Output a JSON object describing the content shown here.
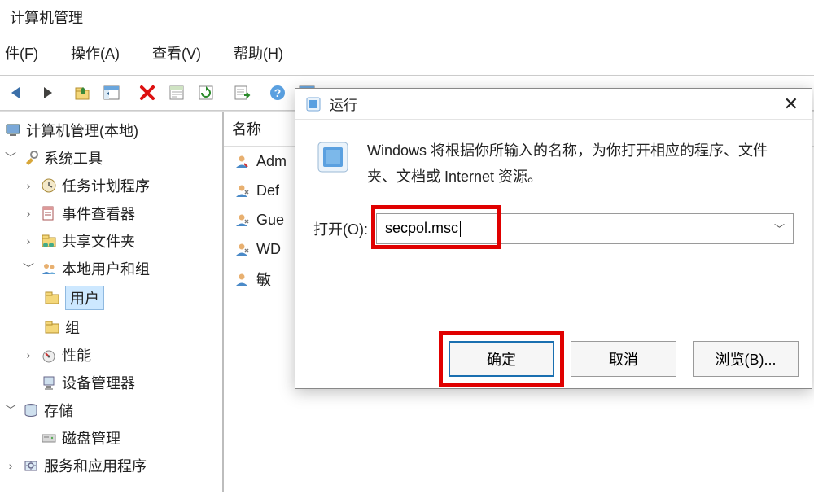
{
  "window": {
    "title": "计算机管理"
  },
  "menu": {
    "file": "件(F)",
    "action": "操作(A)",
    "view": "查看(V)",
    "help": "帮助(H)"
  },
  "tree": {
    "root": "计算机管理(本地)",
    "system_tools": "系统工具",
    "task_scheduler": "任务计划程序",
    "event_viewer": "事件查看器",
    "shared_folders": "共享文件夹",
    "local_users_groups": "本地用户和组",
    "users": "用户",
    "groups": "组",
    "performance": "性能",
    "device_manager": "设备管理器",
    "storage": "存储",
    "disk_management": "磁盘管理",
    "services_apps": "服务和应用程序"
  },
  "right": {
    "col_name": "名称",
    "items": [
      "Adm",
      "Def",
      "Gue",
      "WD",
      "敏"
    ]
  },
  "run": {
    "title": "运行",
    "description": "Windows 将根据你所输入的名称，为你打开相应的程序、文件夹、文档或 Internet 资源。",
    "open_label": "打开(O):",
    "value": "secpol.msc",
    "ok": "确定",
    "cancel": "取消",
    "browse": "浏览(B)..."
  }
}
